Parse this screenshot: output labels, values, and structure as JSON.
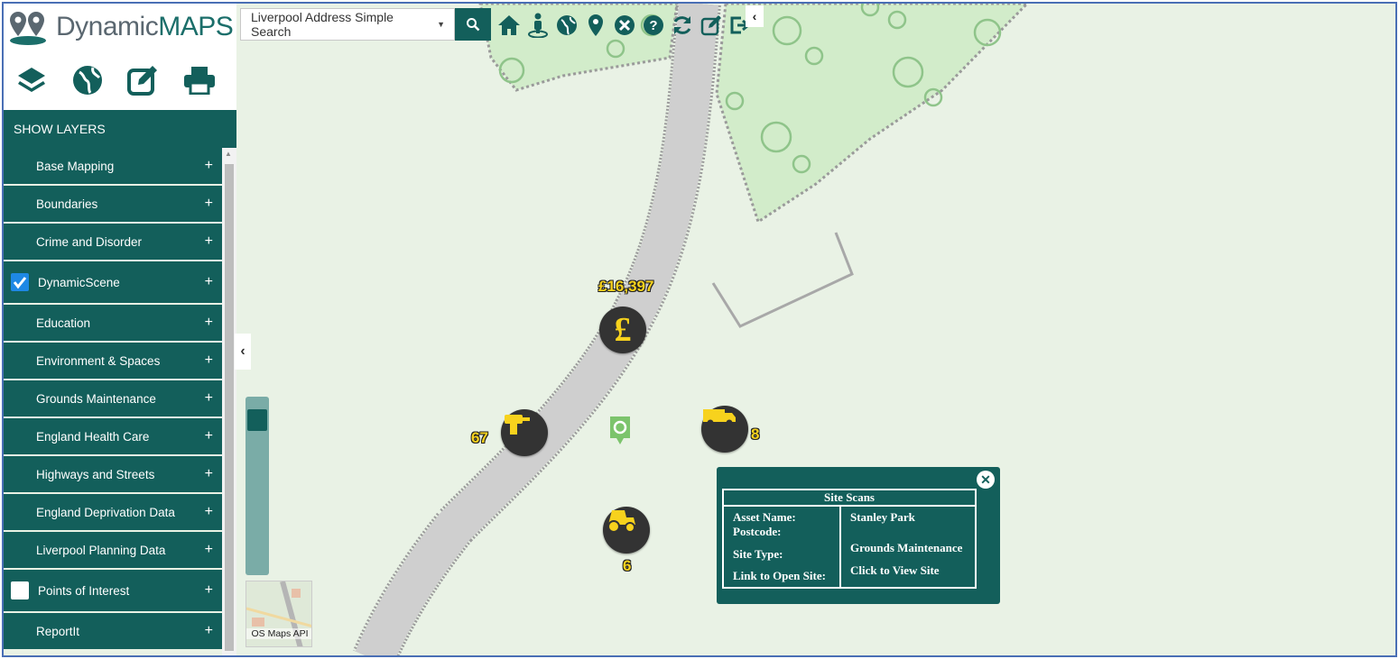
{
  "app": {
    "brand_part1": "Dynamic",
    "brand_part2": "MAPS"
  },
  "search": {
    "selected": "Liverpool Address Simple Search"
  },
  "toolbar": {
    "icons": [
      "home-icon",
      "street-view-icon",
      "globe-icon",
      "map-pin-icon",
      "close-circle-icon",
      "help-icon",
      "refresh-icon",
      "edit-icon",
      "logout-icon"
    ]
  },
  "tools": {
    "icons": [
      "layers-icon",
      "globe-icon",
      "edit-icon",
      "print-icon"
    ]
  },
  "panel": {
    "title": "SHOW LAYERS",
    "layers": [
      {
        "label": "Base Mapping"
      },
      {
        "label": "Boundaries"
      },
      {
        "label": "Crime and Disorder"
      },
      {
        "label": "DynamicScene",
        "checked": true
      },
      {
        "label": "Education"
      },
      {
        "label": "Environment & Spaces"
      },
      {
        "label": "Grounds Maintenance"
      },
      {
        "label": "England Health Care"
      },
      {
        "label": "Highways and Streets"
      },
      {
        "label": "England Deprivation Data"
      },
      {
        "label": "Liverpool Planning Data"
      },
      {
        "label": "Points of Interest",
        "checked": false
      },
      {
        "label": "ReportIt"
      }
    ],
    "plus": "+"
  },
  "minimap": {
    "label": "OS Maps API"
  },
  "markers": {
    "money": {
      "label": "£16,397",
      "icon": "pound-icon"
    },
    "drill": {
      "label": "67",
      "icon": "drill-icon"
    },
    "van": {
      "label": "8",
      "icon": "van-icon"
    },
    "tractor": {
      "label": "6",
      "icon": "tractor-icon"
    },
    "site": {
      "icon": "site-pin-icon"
    }
  },
  "popup": {
    "title": "Site Scans",
    "label_asset": "Asset Name:",
    "label_postcode": "Postcode:",
    "label_site_type": "Site Type:",
    "label_link": "Link to Open Site:",
    "value_asset": "Stanley Park",
    "value_site_type": "Grounds Maintenance",
    "value_link": "Click to View Site"
  },
  "colors": {
    "primary": "#135f5b",
    "accent": "#f7d21d",
    "map_bg": "#e9f2e5",
    "park": "#d2ecca"
  }
}
